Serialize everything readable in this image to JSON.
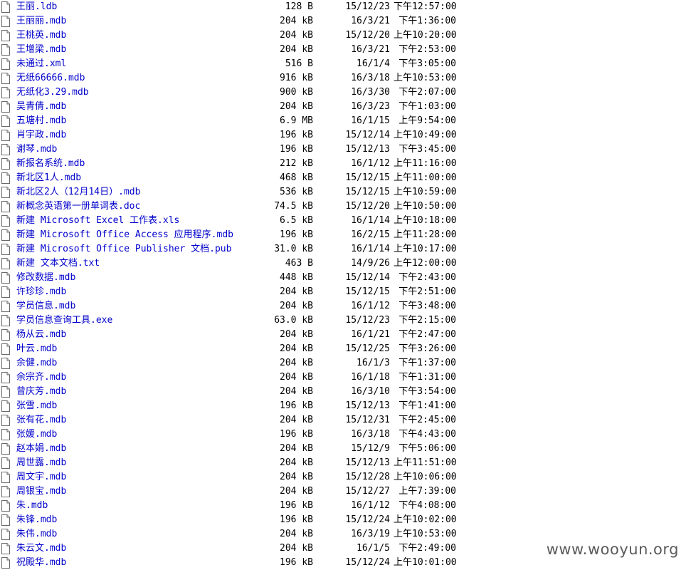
{
  "files": [
    {
      "name": "王丽.ldb",
      "size": "128 B",
      "date": "15/12/23",
      "time": "下午12:57:00"
    },
    {
      "name": "王丽丽.mdb",
      "size": "204 kB",
      "date": "16/3/21",
      "time": "下午1:36:00"
    },
    {
      "name": "王桃英.mdb",
      "size": "204 kB",
      "date": "15/12/20",
      "time": "上午10:20:00"
    },
    {
      "name": "王增梁.mdb",
      "size": "204 kB",
      "date": "16/3/21",
      "time": "下午2:53:00"
    },
    {
      "name": "未通过.xml",
      "size": "516 B",
      "date": "16/1/4",
      "time": "下午3:05:00"
    },
    {
      "name": "无纸66666.mdb",
      "size": "916 kB",
      "date": "16/3/18",
      "time": "上午10:53:00"
    },
    {
      "name": "无纸化3.29.mdb",
      "size": "900 kB",
      "date": "16/3/30",
      "time": "下午2:07:00"
    },
    {
      "name": "吴青倩.mdb",
      "size": "204 kB",
      "date": "16/3/23",
      "time": "下午1:03:00"
    },
    {
      "name": "五塘村.mdb",
      "size": "6.9 MB",
      "date": "16/1/15",
      "time": "上午9:54:00"
    },
    {
      "name": "肖宇政.mdb",
      "size": "196 kB",
      "date": "15/12/14",
      "time": "上午10:49:00"
    },
    {
      "name": "谢琴.mdb",
      "size": "196 kB",
      "date": "15/12/13",
      "time": "下午3:45:00"
    },
    {
      "name": "新报名系统.mdb",
      "size": "212 kB",
      "date": "16/1/12",
      "time": "上午11:16:00"
    },
    {
      "name": "新北区1人.mdb",
      "size": "468 kB",
      "date": "15/12/15",
      "time": "上午11:00:00"
    },
    {
      "name": "新北区2人（12月14日）.mdb",
      "size": "536 kB",
      "date": "15/12/15",
      "time": "上午10:59:00"
    },
    {
      "name": "新概念英语第一册单词表.doc",
      "size": "74.5 kB",
      "date": "15/12/20",
      "time": "上午10:50:00"
    },
    {
      "name": "新建 Microsoft Excel 工作表.xls",
      "size": "6.5 kB",
      "date": "16/1/14",
      "time": "上午10:18:00"
    },
    {
      "name": "新建 Microsoft Office Access 应用程序.mdb",
      "size": "196 kB",
      "date": "16/2/15",
      "time": "上午11:28:00"
    },
    {
      "name": "新建 Microsoft Office Publisher 文档.pub",
      "size": "31.0 kB",
      "date": "16/1/14",
      "time": "上午10:17:00"
    },
    {
      "name": "新建 文本文档.txt",
      "size": "463 B",
      "date": "14/9/26",
      "time": "上午12:00:00"
    },
    {
      "name": "修改数据.mdb",
      "size": "448 kB",
      "date": "15/12/14",
      "time": "下午2:43:00"
    },
    {
      "name": "许珍珍.mdb",
      "size": "204 kB",
      "date": "15/12/15",
      "time": "下午2:51:00"
    },
    {
      "name": "学员信息.mdb",
      "size": "204 kB",
      "date": "16/1/12",
      "time": "下午3:48:00"
    },
    {
      "name": "学员信息查询工具.exe",
      "size": "63.0 kB",
      "date": "15/12/23",
      "time": "下午2:15:00"
    },
    {
      "name": "杨从云.mdb",
      "size": "204 kB",
      "date": "16/1/21",
      "time": "下午2:47:00"
    },
    {
      "name": "叶云.mdb",
      "size": "204 kB",
      "date": "15/12/25",
      "time": "下午3:26:00"
    },
    {
      "name": "余健.mdb",
      "size": "204 kB",
      "date": "16/1/3",
      "time": "下午1:37:00"
    },
    {
      "name": "余宗齐.mdb",
      "size": "204 kB",
      "date": "16/1/18",
      "time": "下午1:31:00"
    },
    {
      "name": "曾庆芳.mdb",
      "size": "204 kB",
      "date": "16/3/10",
      "time": "下午3:54:00"
    },
    {
      "name": "张雪.mdb",
      "size": "196 kB",
      "date": "15/12/13",
      "time": "下午1:41:00"
    },
    {
      "name": "张有花.mdb",
      "size": "204 kB",
      "date": "15/12/31",
      "time": "下午2:45:00"
    },
    {
      "name": "张媛.mdb",
      "size": "196 kB",
      "date": "16/3/18",
      "time": "下午4:43:00"
    },
    {
      "name": "赵本娟.mdb",
      "size": "204 kB",
      "date": "15/12/9",
      "time": "下午5:06:00"
    },
    {
      "name": "周世露.mdb",
      "size": "204 kB",
      "date": "15/12/13",
      "time": "上午11:51:00"
    },
    {
      "name": "周文宇.mdb",
      "size": "204 kB",
      "date": "15/12/28",
      "time": "上午10:06:00"
    },
    {
      "name": "周银宝.mdb",
      "size": "204 kB",
      "date": "15/12/27",
      "time": "上午7:39:00"
    },
    {
      "name": "朱.mdb",
      "size": "196 kB",
      "date": "16/1/12",
      "time": "下午4:08:00"
    },
    {
      "name": "朱锋.mdb",
      "size": "196 kB",
      "date": "15/12/24",
      "time": "上午10:02:00"
    },
    {
      "name": "朱伟.mdb",
      "size": "204 kB",
      "date": "16/3/19",
      "time": "上午10:53:00"
    },
    {
      "name": "朱云文.mdb",
      "size": "204 kB",
      "date": "16/1/5",
      "time": "下午2:49:00"
    },
    {
      "name": "祝殿华.mdb",
      "size": "196 kB",
      "date": "15/12/24",
      "time": "上午10:01:00"
    }
  ],
  "watermark": "www.wooyun.org",
  "colors": {
    "link": "#0000cc",
    "text": "#000000",
    "watermark": "#5a5a5a"
  },
  "icons": {
    "file": "file-icon"
  }
}
